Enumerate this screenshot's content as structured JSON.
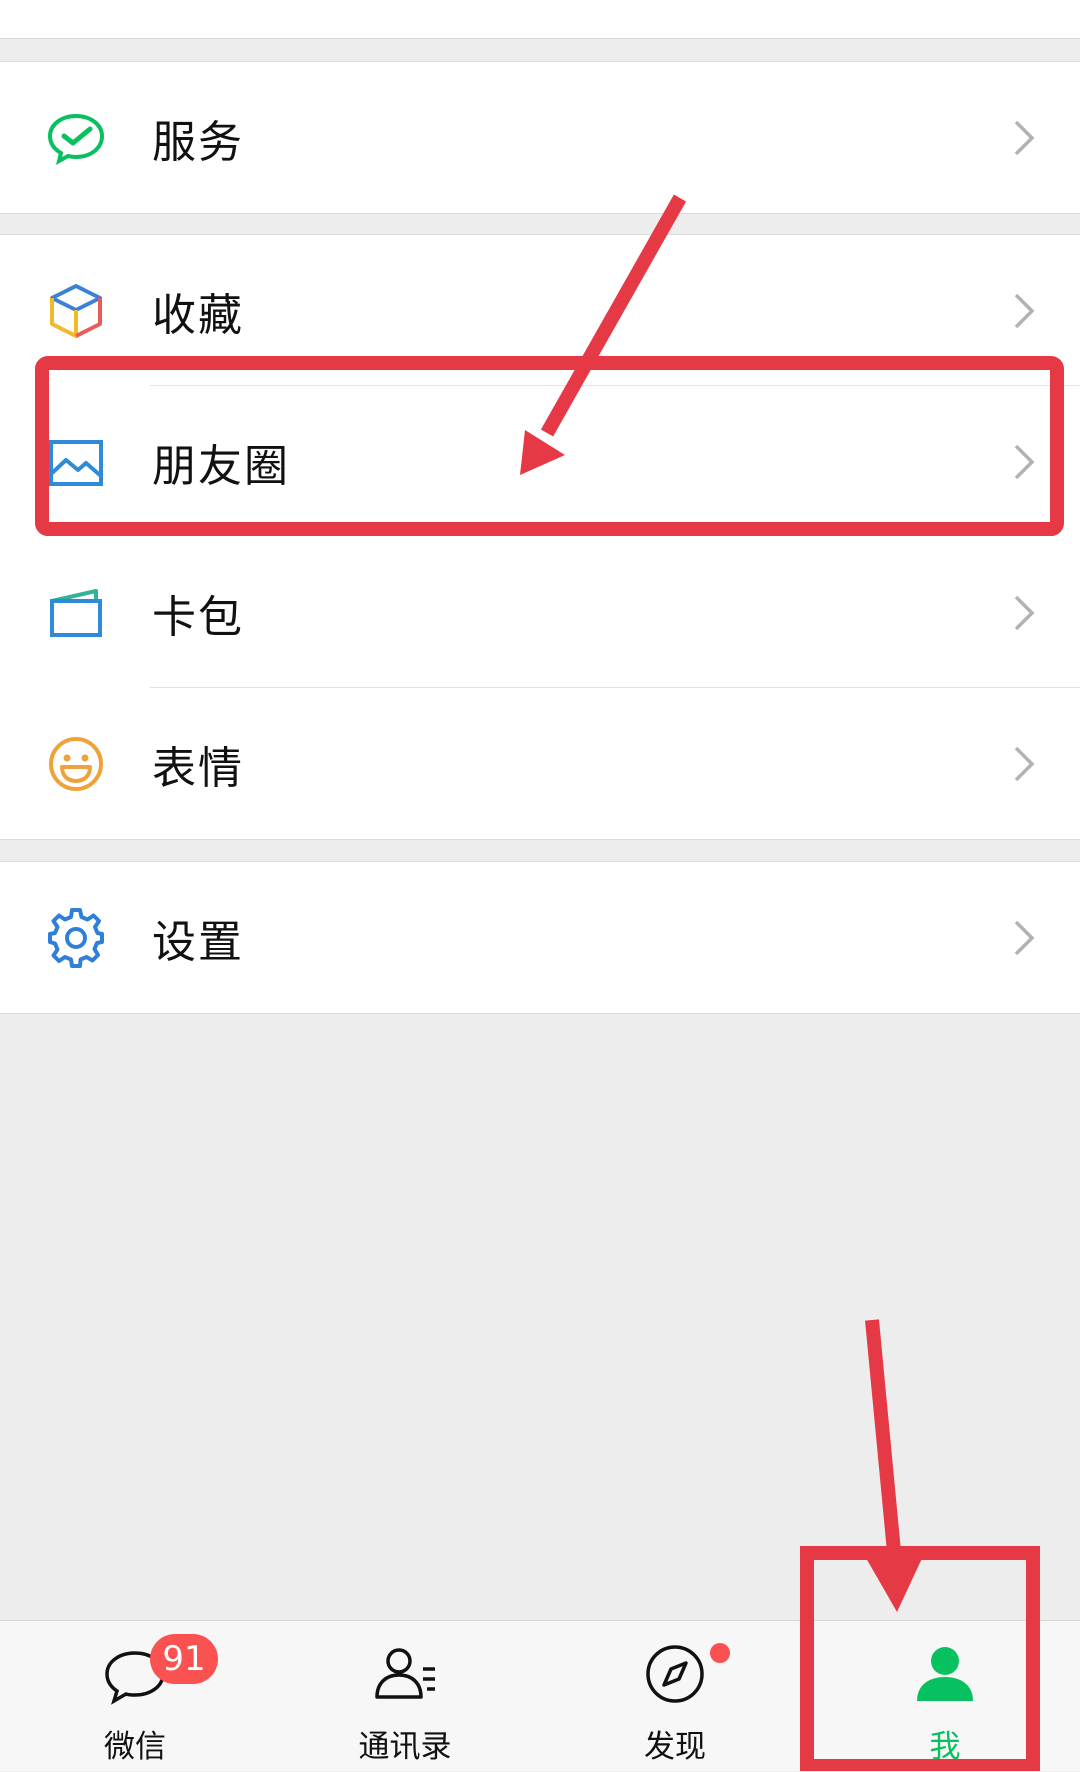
{
  "menu": {
    "service": {
      "label": "服务",
      "icon": "service-check-icon"
    },
    "favorites": {
      "label": "收藏",
      "icon": "favorites-cube-icon"
    },
    "moments": {
      "label": "朋友圈",
      "icon": "moments-photo-icon"
    },
    "cards": {
      "label": "卡包",
      "icon": "card-wallet-icon"
    },
    "stickers": {
      "label": "表情",
      "icon": "smiley-face-icon"
    },
    "settings": {
      "label": "设置",
      "icon": "gear-icon"
    }
  },
  "tabbar": {
    "chats": {
      "label": "微信",
      "badge": "91",
      "icon": "chat-bubble-icon"
    },
    "contacts": {
      "label": "通讯录",
      "icon": "contacts-icon"
    },
    "discover": {
      "label": "发现",
      "icon": "compass-icon",
      "dot": true
    },
    "me": {
      "label": "我",
      "icon": "person-icon",
      "active": true
    }
  },
  "colors": {
    "accent": "#07c160",
    "badge": "#fa5151",
    "annotation": "#e63946"
  }
}
